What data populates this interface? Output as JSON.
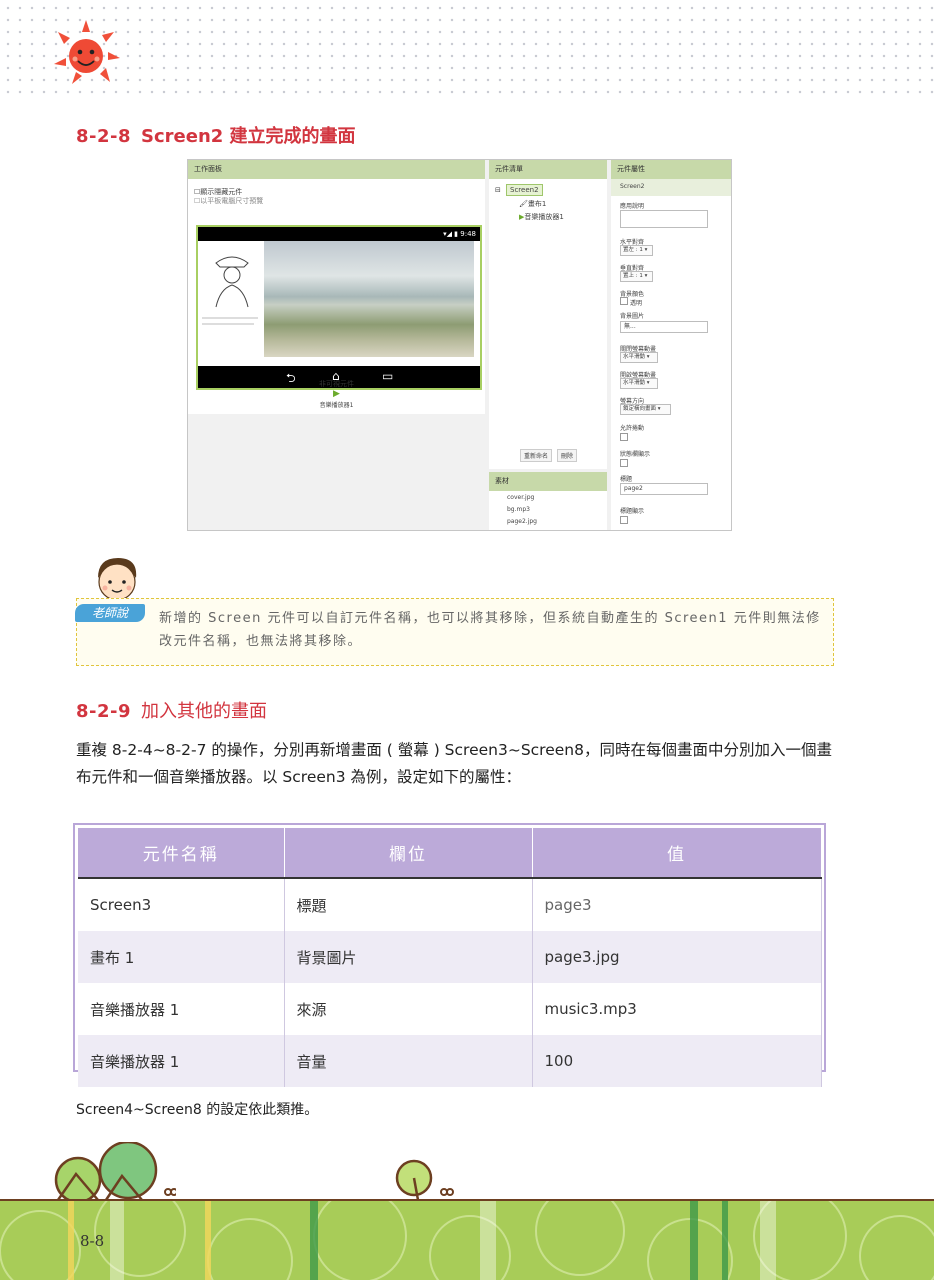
{
  "section1": {
    "number": "8-2-8",
    "title": "Screen2 建立完成的畫面"
  },
  "screenshot": {
    "viewer": {
      "header": "工作面板",
      "check1": "顯示隱藏元件",
      "check2": "以平板電腦尺寸預覽",
      "status_time": "9:48",
      "non_visible_label": "非可視元件",
      "non_visible_item": "音樂播放器1"
    },
    "components": {
      "header": "元件清單",
      "root": "Screen2",
      "child1": "畫布1",
      "child2": "音樂播放器1",
      "rename_button": "重新命名",
      "delete_button": "刪除"
    },
    "media": {
      "header": "素材",
      "files": [
        "cover.jpg",
        "bg.mp3",
        "page2.jpg"
      ]
    },
    "properties": {
      "header": "元件屬性",
      "component": "Screen2",
      "about_label": "應用說明",
      "halign_label": "水平對齊",
      "halign_value": "置左 : 1 ▾",
      "valign_label": "垂直對齊",
      "valign_value": "置上 : 1 ▾",
      "bgcolor_label": "背景顏色",
      "bgcolor_value": "透明",
      "bgimage_label": "背景圖片",
      "bgimage_value": "無...",
      "close_anim_label": "關閉螢幕動畫",
      "close_anim_value": "水平滑動 ▾",
      "open_anim_label": "開啟螢幕動畫",
      "open_anim_value": "水平滑動 ▾",
      "orientation_label": "螢幕方向",
      "orientation_value": "鎖定橫向畫面 ▾",
      "scroll_label": "允許捲動",
      "statusbar_label": "狀態欄顯示",
      "title_label": "標題",
      "title_value": "page2",
      "title_visible_label": "標題顯示"
    }
  },
  "note": {
    "badge": "老師說",
    "text": "新增的 Screen 元件可以自訂元件名稱，也可以將其移除，但系統自動產生的 Screen1 元件則無法修改元件名稱，也無法將其移除。"
  },
  "section2": {
    "number": "8-2-9",
    "title": "加入其他的畫面"
  },
  "paragraph": "重複 8-2-4~8-2-7 的操作，分別再新增畫面 ( 螢幕 ) Screen3~Screen8，同時在每個畫面中分別加入一個畫布元件和一個音樂播放器。以 Screen3 為例，設定如下的屬性：",
  "table": {
    "headers": [
      "元件名稱",
      "欄位",
      "值"
    ],
    "rows": [
      [
        "Screen3",
        "標題",
        "page3"
      ],
      [
        "畫布 1",
        "背景圖片",
        "page3.jpg"
      ],
      [
        "音樂播放器 1",
        "來源",
        "music3.mp3"
      ],
      [
        "音樂播放器 1",
        "音量",
        "100"
      ]
    ]
  },
  "footnote": "Screen4~Screen8 的設定依此類推。",
  "page_number": "8-8",
  "colors": {
    "heading_red": "#d2353f",
    "table_header": "#bcaad9",
    "footer_green": "#a8cc58"
  }
}
